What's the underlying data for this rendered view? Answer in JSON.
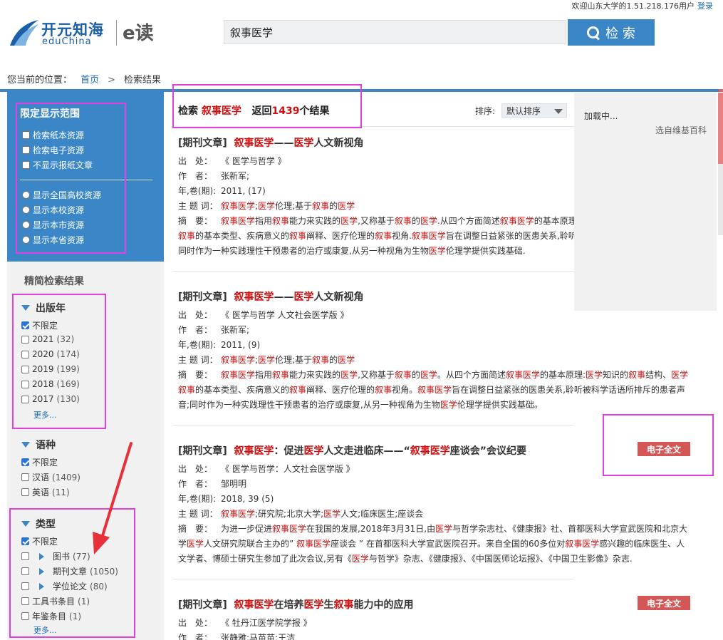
{
  "header": {
    "welcome": "欢迎山东大学的1.51.218.176用户",
    "login": "登录",
    "logo_cn": "开元知海",
    "logo_en": "eduChina",
    "logo_edu": "e读",
    "search_value": "叙事医学",
    "search_button": "检 索"
  },
  "breadcrumb": {
    "prefix": "您当前的位置：",
    "home": "首页",
    "separator": ">",
    "current": "检索结果"
  },
  "scope": {
    "title": "限定显示范围",
    "checkboxes": [
      "检索纸本资源",
      "检索电子资源",
      "不显示报纸文章"
    ],
    "radios": [
      "显示全国高校资源",
      "显示本校资源",
      "显示本市资源",
      "显示本省资源"
    ]
  },
  "refine": {
    "title": "精简检索结果",
    "year": {
      "title": "出版年",
      "items": [
        {
          "label": "不限定",
          "count": "",
          "checked": true
        },
        {
          "label": "2021",
          "count": "(32)"
        },
        {
          "label": "2020",
          "count": "(174)"
        },
        {
          "label": "2019",
          "count": "(199)"
        },
        {
          "label": "2018",
          "count": "(169)"
        },
        {
          "label": "2017",
          "count": "(130)"
        }
      ],
      "more": "更多..."
    },
    "language": {
      "title": "语种",
      "items": [
        {
          "label": "不限定",
          "count": "",
          "checked": true
        },
        {
          "label": "汉语",
          "count": "(1409)"
        },
        {
          "label": "英语",
          "count": "(11)"
        }
      ]
    },
    "type": {
      "title": "类型",
      "items": [
        {
          "label": "不限定",
          "count": "",
          "checked": true
        },
        {
          "label": "图书",
          "count": "(77)"
        },
        {
          "label": "期刊文章",
          "count": "(1050)"
        },
        {
          "label": "学位论文",
          "count": "(80)"
        },
        {
          "label": "工具书条目",
          "count": "(1)"
        },
        {
          "label": "年鉴条目",
          "count": "(1)"
        }
      ],
      "more": "更多..."
    }
  },
  "results": {
    "prefix": "检索",
    "keyword": "叙事医学",
    "returned": "返回",
    "count": "1439",
    "suffix": "个结果",
    "sort_label": "排序:",
    "sort_value": "默认排序",
    "full_text": "电子全文",
    "labels": {
      "source": "出　处：",
      "author": "作　者：",
      "year": "年,卷(期):",
      "subject": "主 题 词：",
      "abstract": "摘　要："
    },
    "records": [
      {
        "type": "[期刊文章]",
        "title_html": "<span class=\"red\">叙事医学</span>——<span class=\"red\">医学</span>人文新视角",
        "source": "《 医学与哲学 》",
        "author": "张新军;",
        "year": "2011, (17)",
        "subject_html": "<span class=\"red\">叙事医学</span>;<span class=\"red\">医学</span>伦理;基于<span class=\"red\">叙事</span>的<span class=\"red\">医学</span>",
        "abstract_html": [
          "<span class=\"red\">叙事医学</span>指用<span class=\"red\">叙事</span>能力来实践的<span class=\"red\">医学</span>,又称基于<span class=\"red\">叙事</span>的<span class=\"red\">医学</span>.从四个方面简述<span class=\"red\">叙事医学</span>的基本原理",
          "<span class=\"red\">叙事</span>的基本类型、疾病意义的<span class=\"red\">叙事</span>阐释、医疗伦理的<span class=\"red\">叙事</span>视角.<span class=\"red\">叙事医学</span>旨在调整日益紧张的医患关系,聆听",
          "同时作为一种实践理性干预患者的治疗或康复,从另一种视角为生物<span class=\"red\">医学</span>伦理学提供实践基础."
        ]
      },
      {
        "type": "[期刊文章]",
        "title_html": "<span class=\"red\">叙事医学</span>——<span class=\"red\">医学</span>人文新视角",
        "source": "《 医学与哲学 人文社会医学版 》",
        "author": "张新军;",
        "year": "2011, (9)",
        "subject_html": "<span class=\"red\">叙事医学</span>;<span class=\"red\">医学</span>伦理;基于<span class=\"red\">叙事</span>的<span class=\"red\">医学</span>",
        "abstract_html": [
          "<span class=\"red\">叙事医学</span>指用<span class=\"red\">叙事</span>能力来实践的<span class=\"red\">医学</span>,又称基于<span class=\"red\">叙事</span>的<span class=\"red\">医学</span>。从四个方面简述<span class=\"red\">叙事医学</span>的基本原理:<span class=\"red\">医学</span>知识的<span class=\"red\">叙事</span>结构、<span class=\"red\">医学</span>",
          "<span class=\"red\">叙事</span>的基本类型、疾病意义的<span class=\"red\">叙事</span>阐释、医疗伦理的<span class=\"red\">叙事</span>视角。<span class=\"red\">叙事医学</span>旨在调整日益紧张的医患关系,聆听被科学话语所排斥的患者声",
          "音;同时作为一种实践理性干预患者的治疗或康复,从另一种视角为生物<span class=\"red\">医学</span>伦理学提供实践基础。"
        ]
      },
      {
        "type": "[期刊文章]",
        "title_html": "<span class=\"red\">叙事医学</span>：促进<span class=\"red\">医学</span>人文走进临床——“<span class=\"red\">叙事医学</span>座谈会”会议纪要",
        "source": "《 医学与哲学：人文社会医学版 》",
        "author": "邹明明",
        "year": "2018, 39 (5)",
        "subject_html": "<span class=\"red\">叙事医学</span>;研究院;北京大学;<span class=\"red\">医学</span>人文;临床医生;座谈会",
        "abstract_html": [
          "为进一步促进<span class=\"red\">叙事医学</span>在我国的发展,2018年3月31日,由<span class=\"red\">医学</span>与哲学杂志社、《健康报》社、首都医科大学宣武医院和北京大",
          "学<span class=\"red\">医学</span>人文研究院联合主办的” <span class=\"red\">叙事医学</span>座谈会 ” 在首都医科大学宣武医院召开。来自全国的60多位对<span class=\"red\">叙事医学</span>感兴趣的临床医生、人",
          "文学者、博硕士研究生参加了此次会议,另有《<span class=\"red\">医学</span>与哲学》杂志、《健康报》、《中国医师论坛报》、《中国卫生影像》杂志."
        ]
      },
      {
        "type": "[期刊文章]",
        "title_html": "<span class=\"red\">叙事医学</span>在培养<span class=\"red\">医学</span>生<span class=\"red\">叙事</span>能力中的应用",
        "source": "《 牡丹江医学院学报 》",
        "author": "张静雅;马苗苗;王洁"
      }
    ]
  },
  "side_panel": {
    "loading": "加载中...",
    "wiki": "选自维基百科"
  }
}
